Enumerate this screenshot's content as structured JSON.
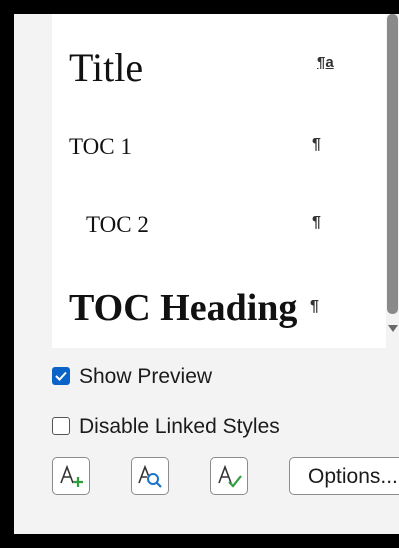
{
  "styles_list": {
    "items": [
      {
        "name": "Title",
        "mark": "¶a"
      },
      {
        "name": "TOC 1",
        "mark": "¶"
      },
      {
        "name": "TOC 2",
        "mark": "¶"
      },
      {
        "name": "TOC Heading",
        "mark": "¶"
      }
    ]
  },
  "options": {
    "show_preview": {
      "label": "Show Preview",
      "checked": true
    },
    "disable_linked_styles": {
      "label": "Disable Linked Styles",
      "checked": false
    }
  },
  "toolbar": {
    "new_style_icon": "new-style-icon",
    "style_inspector_icon": "style-inspector-icon",
    "manage_styles_icon": "manage-styles-icon",
    "options_label": "Options..."
  },
  "colors": {
    "accent": "#0a64c8",
    "new_style_plus": "#2e9e3e",
    "inspector_lens": "#1a73c9",
    "manage_check": "#2e9e3e"
  }
}
